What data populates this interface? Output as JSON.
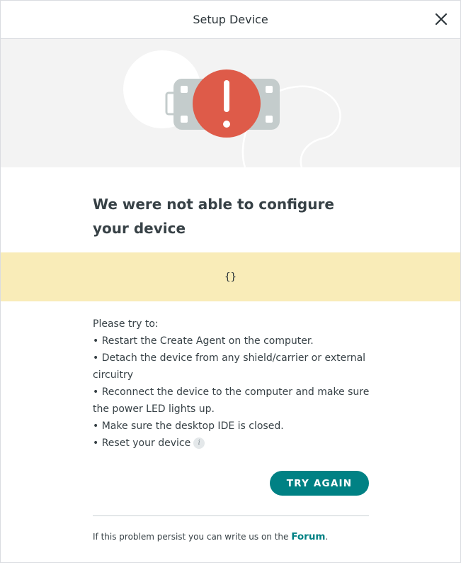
{
  "dialog": {
    "title": "Setup Device",
    "close_icon": "close-icon"
  },
  "hero": {
    "illustration": "device-error-illustration",
    "colors": {
      "alert": "#de5b49",
      "board": "#c4cccc",
      "background": "#f3f3f3"
    }
  },
  "main": {
    "heading": "We were not able to configure your device",
    "code": "{}",
    "instructions": {
      "intro": "Please try to:",
      "items": [
        "• Restart the Create Agent on the computer.",
        "• Detach the device from any shield/carrier or external circuitry",
        "• Reconnect the device to the computer and make sure the power LED lights up.",
        "• Make sure the desktop IDE is closed.",
        "• Reset your device"
      ],
      "info_icon": "info-icon"
    },
    "try_again_label": "TRY AGAIN"
  },
  "footer": {
    "text": "If this problem persist you can write us on the ",
    "link_label": "Forum",
    "end": "."
  },
  "colors": {
    "accent": "#008184",
    "code_band": "#f9ecb8"
  }
}
